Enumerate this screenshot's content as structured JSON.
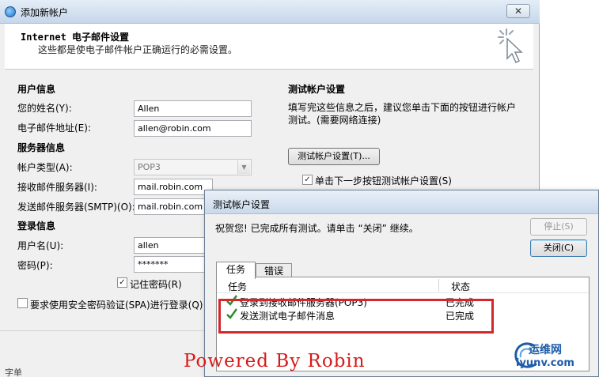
{
  "window": {
    "title": "添加新帐户",
    "close_glyph": "✕"
  },
  "header": {
    "title": "Internet 电子邮件设置",
    "subtitle": "这些都是使电子邮件帐户正确运行的必需设置。"
  },
  "user_info": {
    "heading": "用户信息",
    "name_label": "您的姓名(Y):",
    "name_value": "Allen",
    "email_label": "电子邮件地址(E):",
    "email_value": "allen@robin.com"
  },
  "server_info": {
    "heading": "服务器信息",
    "account_type_label": "帐户类型(A):",
    "account_type_value": "POP3",
    "incoming_label": "接收邮件服务器(I):",
    "incoming_value": "mail.robin.com",
    "outgoing_label": "发送邮件服务器(SMTP)(O):",
    "outgoing_value": "mail.robin.com"
  },
  "login_info": {
    "heading": "登录信息",
    "username_label": "用户名(U):",
    "username_value": "allen",
    "password_label": "密码(P):",
    "password_value": "*******",
    "remember_label": "记住密码(R)",
    "remember_checked": true,
    "spa_label": "要求使用安全密码验证(SPA)进行登录(Q)",
    "spa_checked": false
  },
  "test_settings": {
    "heading": "测试帐户设置",
    "description_line1": "填写完这些信息之后，建议您单击下面的按钮进行帐户",
    "description_line2": "测试。(需要网络连接)",
    "test_button": "测试帐户设置(T)...",
    "auto_test_label": "单击下一步按钮测试帐户设置(S)",
    "auto_test_checked": true
  },
  "dialog": {
    "title": "测试帐户设置",
    "message": "祝贺您! 已完成所有测试。请单击 “关闭” 继续。",
    "stop_button": "停止(S)",
    "close_button": "关闭(C)",
    "tabs": [
      "任务",
      "错误"
    ],
    "columns": {
      "task": "任务",
      "status": "状态"
    },
    "rows": [
      {
        "task": "登录到接收邮件服务器(POP3)",
        "status": "已完成"
      },
      {
        "task": "发送测试电子邮件消息",
        "status": "已完成"
      }
    ]
  },
  "bottom": {
    "partial_text": "字单"
  },
  "watermark": "Powered By Robin",
  "logo": {
    "name": "运维网",
    "url_text": "iyunv.com"
  },
  "colors": {
    "highlight": "#d2272b",
    "check": "#2f8a2f",
    "logo": "#1d5ca8",
    "watermark": "#d61a1a"
  }
}
